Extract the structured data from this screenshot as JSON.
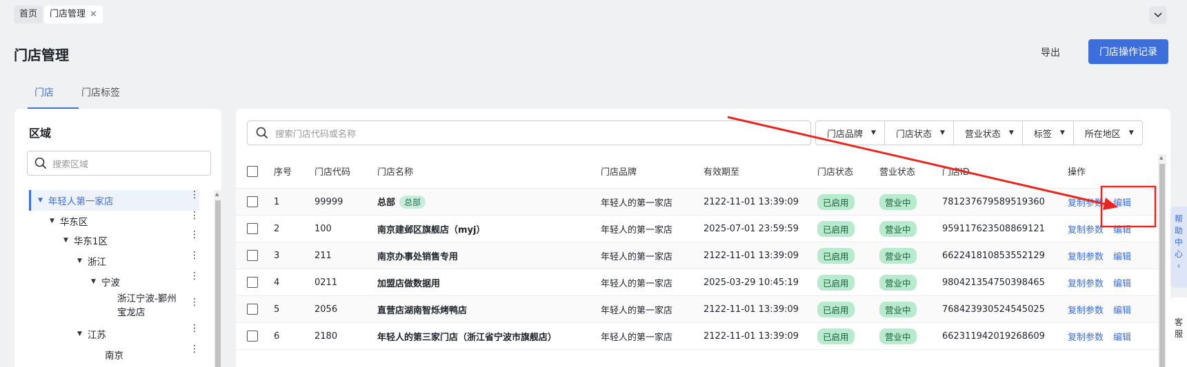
{
  "breadcrumb": {
    "home": "首页",
    "current": "门店管理",
    "close": "×"
  },
  "header": {
    "title": "门店管理",
    "export": "导出",
    "log_button": "门店操作记录"
  },
  "tabs": [
    {
      "label": "门店"
    },
    {
      "label": "门店标签"
    }
  ],
  "region": {
    "title": "区域",
    "search_placeholder": "搜索区域",
    "tree": [
      {
        "label": "年轻人第一家店",
        "selected": true
      },
      {
        "label": "华东区"
      },
      {
        "label": "华东1区"
      },
      {
        "label": "浙江"
      },
      {
        "label": "宁波"
      },
      {
        "label_line1": "浙江宁波-鄞州",
        "label_line2": "宝龙店"
      },
      {
        "label": "江苏"
      },
      {
        "label": "南京"
      }
    ]
  },
  "store": {
    "search_placeholder": "搜索门店代码或名称",
    "filters": [
      "门店品牌",
      "门店状态",
      "营业状态",
      "标签",
      "所在地区"
    ],
    "columns": [
      "序号",
      "门店代码",
      "门店名称",
      "门店品牌",
      "有效期至",
      "门店状态",
      "营业状态",
      "门店ID",
      "操作"
    ],
    "rows": [
      {
        "no": "1",
        "code": "99999",
        "name": "总部",
        "tag": "总部",
        "brand": "年轻人的第一家店",
        "expiry": "2122-11-01 13:39:09",
        "status": "已启用",
        "biz": "营业中",
        "id": "781237679589519360",
        "copy": "复制参数",
        "edit": "编辑"
      },
      {
        "no": "2",
        "code": "100",
        "name": "南京建邺区旗舰店（myj）",
        "brand": "年轻人的第一家店",
        "expiry": "2025-07-01 23:59:59",
        "status": "已启用",
        "biz": "营业中",
        "id": "959117623508869121",
        "copy": "复制参数",
        "edit": "编辑"
      },
      {
        "no": "3",
        "code": "211",
        "name": "南京办事处销售专用",
        "brand": "年轻人的第一家店",
        "expiry": "2122-11-01 13:39:09",
        "status": "已启用",
        "biz": "营业中",
        "id": "662241810853552129",
        "copy": "复制参数",
        "edit": "编辑"
      },
      {
        "no": "4",
        "code": "0211",
        "name": "加盟店做数据用",
        "brand": "年轻人的第一家店",
        "expiry": "2025-03-29 10:45:19",
        "status": "已启用",
        "biz": "营业中",
        "id": "980421354750398465",
        "copy": "复制参数",
        "edit": "编辑"
      },
      {
        "no": "5",
        "code": "2056",
        "name": "直营店湖南智烁烤鸭店",
        "brand": "年轻人的第一家店",
        "expiry": "2122-11-01 13:39:09",
        "status": "已启用",
        "biz": "营业中",
        "id": "768423930524545025",
        "copy": "复制参数",
        "edit": "编辑"
      },
      {
        "no": "6",
        "code": "2180",
        "name": "年轻人的第三家门店（浙江省宁波市旗舰店）",
        "brand": "年轻人的第一家店",
        "expiry": "2122-11-01 13:39:09",
        "status": "已启用",
        "biz": "营业中",
        "id": "662311942019268609",
        "copy": "复制参数",
        "edit": "编辑"
      }
    ]
  },
  "side": {
    "help": [
      "帮",
      "助",
      "中",
      "心",
      "‹"
    ],
    "service": [
      "客",
      "服"
    ]
  },
  "colors": {
    "primary": "#3c6fdc",
    "annotation": "#e8261f",
    "pill_bg": "#b8eacd"
  }
}
